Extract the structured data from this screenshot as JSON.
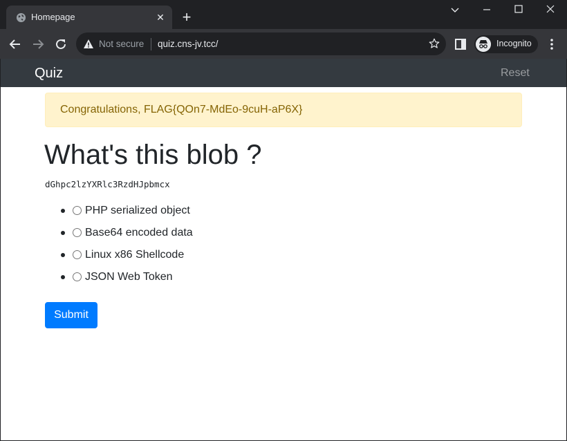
{
  "browser": {
    "tab_title": "Homepage",
    "new_tab_symbol": "+",
    "security_label": "Not secure",
    "url": "quiz.cns-jv.tcc/",
    "profile_label": "Incognito",
    "icons": {
      "favicon": "globe-icon",
      "back": "back-arrow-icon",
      "forward": "forward-arrow-icon",
      "reload": "reload-icon",
      "warning": "warning-icon",
      "bookmark": "star-icon",
      "side_panel": "side-panel-icon",
      "incognito": "incognito-icon",
      "menu": "kebab-menu-icon"
    }
  },
  "navbar": {
    "brand": "Quiz",
    "reset_label": "Reset"
  },
  "alert": {
    "message": "Congratulations, FLAG{QOn7-MdEo-9cuH-aP6X}"
  },
  "quiz": {
    "title": "What's this blob ?",
    "blob": "dGhpc2lzYXRlc3RzdHJpbmcx",
    "options": [
      {
        "label": "PHP serialized object",
        "selected": false
      },
      {
        "label": "Base64 encoded data",
        "selected": false
      },
      {
        "label": "Linux x86 Shellcode",
        "selected": false
      },
      {
        "label": "JSON Web Token",
        "selected": false
      }
    ],
    "submit_label": "Submit"
  },
  "colors": {
    "navbar_bg": "#343a40",
    "alert_bg": "#fff3cd",
    "alert_text": "#856404",
    "primary": "#007bff"
  }
}
